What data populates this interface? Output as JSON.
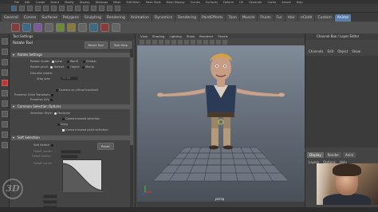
{
  "menubar": [
    "File",
    "Edit",
    "Create",
    "Select",
    "Modify",
    "Display",
    "Windows",
    "Mesh",
    "Edit Mesh",
    "Mesh Tools",
    "Mesh Display",
    "Curves",
    "Surfaces",
    "Deform",
    "UV",
    "Generate",
    "Cache",
    "Arnold",
    "Help"
  ],
  "shelf_tabs": [
    "General",
    "Curves",
    "Surfaces",
    "Polygons",
    "Sculpting",
    "Rendering",
    "Animation",
    "Dynamics",
    "Rendering",
    "PaintEffects",
    "Toon",
    "Muscle",
    "Fluids",
    "Fur",
    "Hair",
    "nCloth",
    "Custom",
    "Anime"
  ],
  "active_shelf_tab": "Anime",
  "tool_settings": {
    "title": "Tool Settings",
    "tool_name": "Rotate Tool",
    "reset_label": "Reset Tool",
    "help_label": "Tool Help",
    "sections": {
      "rotate": "Rotate Settings",
      "common": "Common Selection Options",
      "soft": "Soft Selection"
    },
    "rotate_mode_label": "Rotate mode:",
    "rotate_modes": [
      "Local",
      "World",
      "Gimbal"
    ],
    "rotate_pivot_label": "Rotate pivot:",
    "pivot_options": [
      "Default",
      "Object",
      "Manip"
    ],
    "discrete_label": "Discrete rotate:",
    "step_label": "Step size:",
    "step_value": "15.00",
    "camera_based": "Camera as virtual trackball",
    "preserve_child": "Preserve Child Transform",
    "preserve_uvs": "Preserve UVs",
    "selection_style_label": "Selection Style:",
    "marquee": "Marquee",
    "camera_based_sel": "Camera based selection",
    "drag": "Drag",
    "camera_based_paint": "Camera based paint selection",
    "soft_select_label": "Soft Select:",
    "reset_btn": "Reset",
    "falloff_mode": "Falloff mode:",
    "falloff_radius": "Falloff radius:",
    "falloff_curve": "Falloff curve:"
  },
  "viewport": {
    "menus": [
      "View",
      "Shading",
      "Lighting",
      "Show",
      "Renderer",
      "Panels"
    ],
    "camera_label": "persp"
  },
  "channel_box": {
    "title": "Channel Box / Layer Editor",
    "menus": [
      "Channels",
      "Edit",
      "Object",
      "Show"
    ]
  },
  "layers": {
    "tabs": [
      "Display",
      "Render",
      "Anim"
    ],
    "active_tab": "Display",
    "menus": [
      "Layers",
      "Options",
      "Help"
    ]
  },
  "logo_text": "3D"
}
